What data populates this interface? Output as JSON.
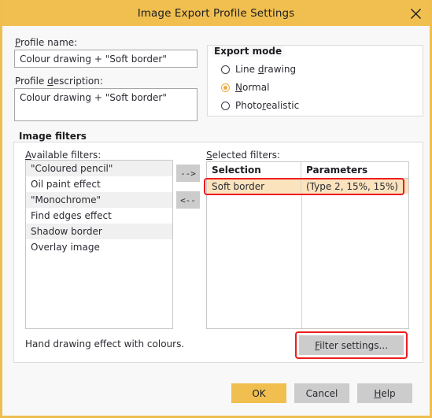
{
  "window": {
    "title": "Image Export Profile Settings",
    "close_icon": "close-icon"
  },
  "profile": {
    "name_label_pre": "P",
    "name_label_post": "rofile name:",
    "name_value": "Colour drawing + \"Soft border\"",
    "description_label_pre": "Profile ",
    "description_label_accel": "d",
    "description_label_post": "escription:",
    "description_value": "Colour drawing + \"Soft border\""
  },
  "export_mode": {
    "title": "Export mode",
    "options": [
      {
        "label_pre": "Line ",
        "label_accel": "d",
        "label_post": "rawing",
        "text": "Line drawing",
        "selected": false
      },
      {
        "label_pre": "",
        "label_accel": "N",
        "label_post": "ormal",
        "text": "Normal",
        "selected": true
      },
      {
        "label_pre": "Photo",
        "label_accel": "r",
        "label_post": "ealistic",
        "text": "Photorealistic",
        "selected": false
      }
    ]
  },
  "image_filters": {
    "title": "Image filters",
    "available_label_accel": "A",
    "available_label_post": "vailable filters:",
    "available_items": [
      "\"Coloured pencil\"",
      "Oil paint effect",
      "\"Monochrome\"",
      "Find edges effect",
      "Shadow border",
      "Overlay image"
    ],
    "add_button": "-->",
    "remove_button": "<--",
    "selected_label_accel": "S",
    "selected_label_post": "elected filters:",
    "columns": [
      "Selection",
      "Parameters"
    ],
    "rows": [
      {
        "selection": "Soft border",
        "parameters": "(Type 2, 15%, 15%)",
        "highlighted": true
      }
    ],
    "description": "Hand drawing effect with colours.",
    "filter_settings_button_accel": "F",
    "filter_settings_button_post": "ilter settings..."
  },
  "footer": {
    "ok": "OK",
    "cancel": "Cancel",
    "help_accel": "H",
    "help_post": "elp"
  },
  "colors": {
    "titlebar": "#f0bf4f",
    "accent": "#eeab3a",
    "highlight_row": "#fae3bd",
    "annotation": "#ee1c1c",
    "button_face": "#cccccc"
  }
}
